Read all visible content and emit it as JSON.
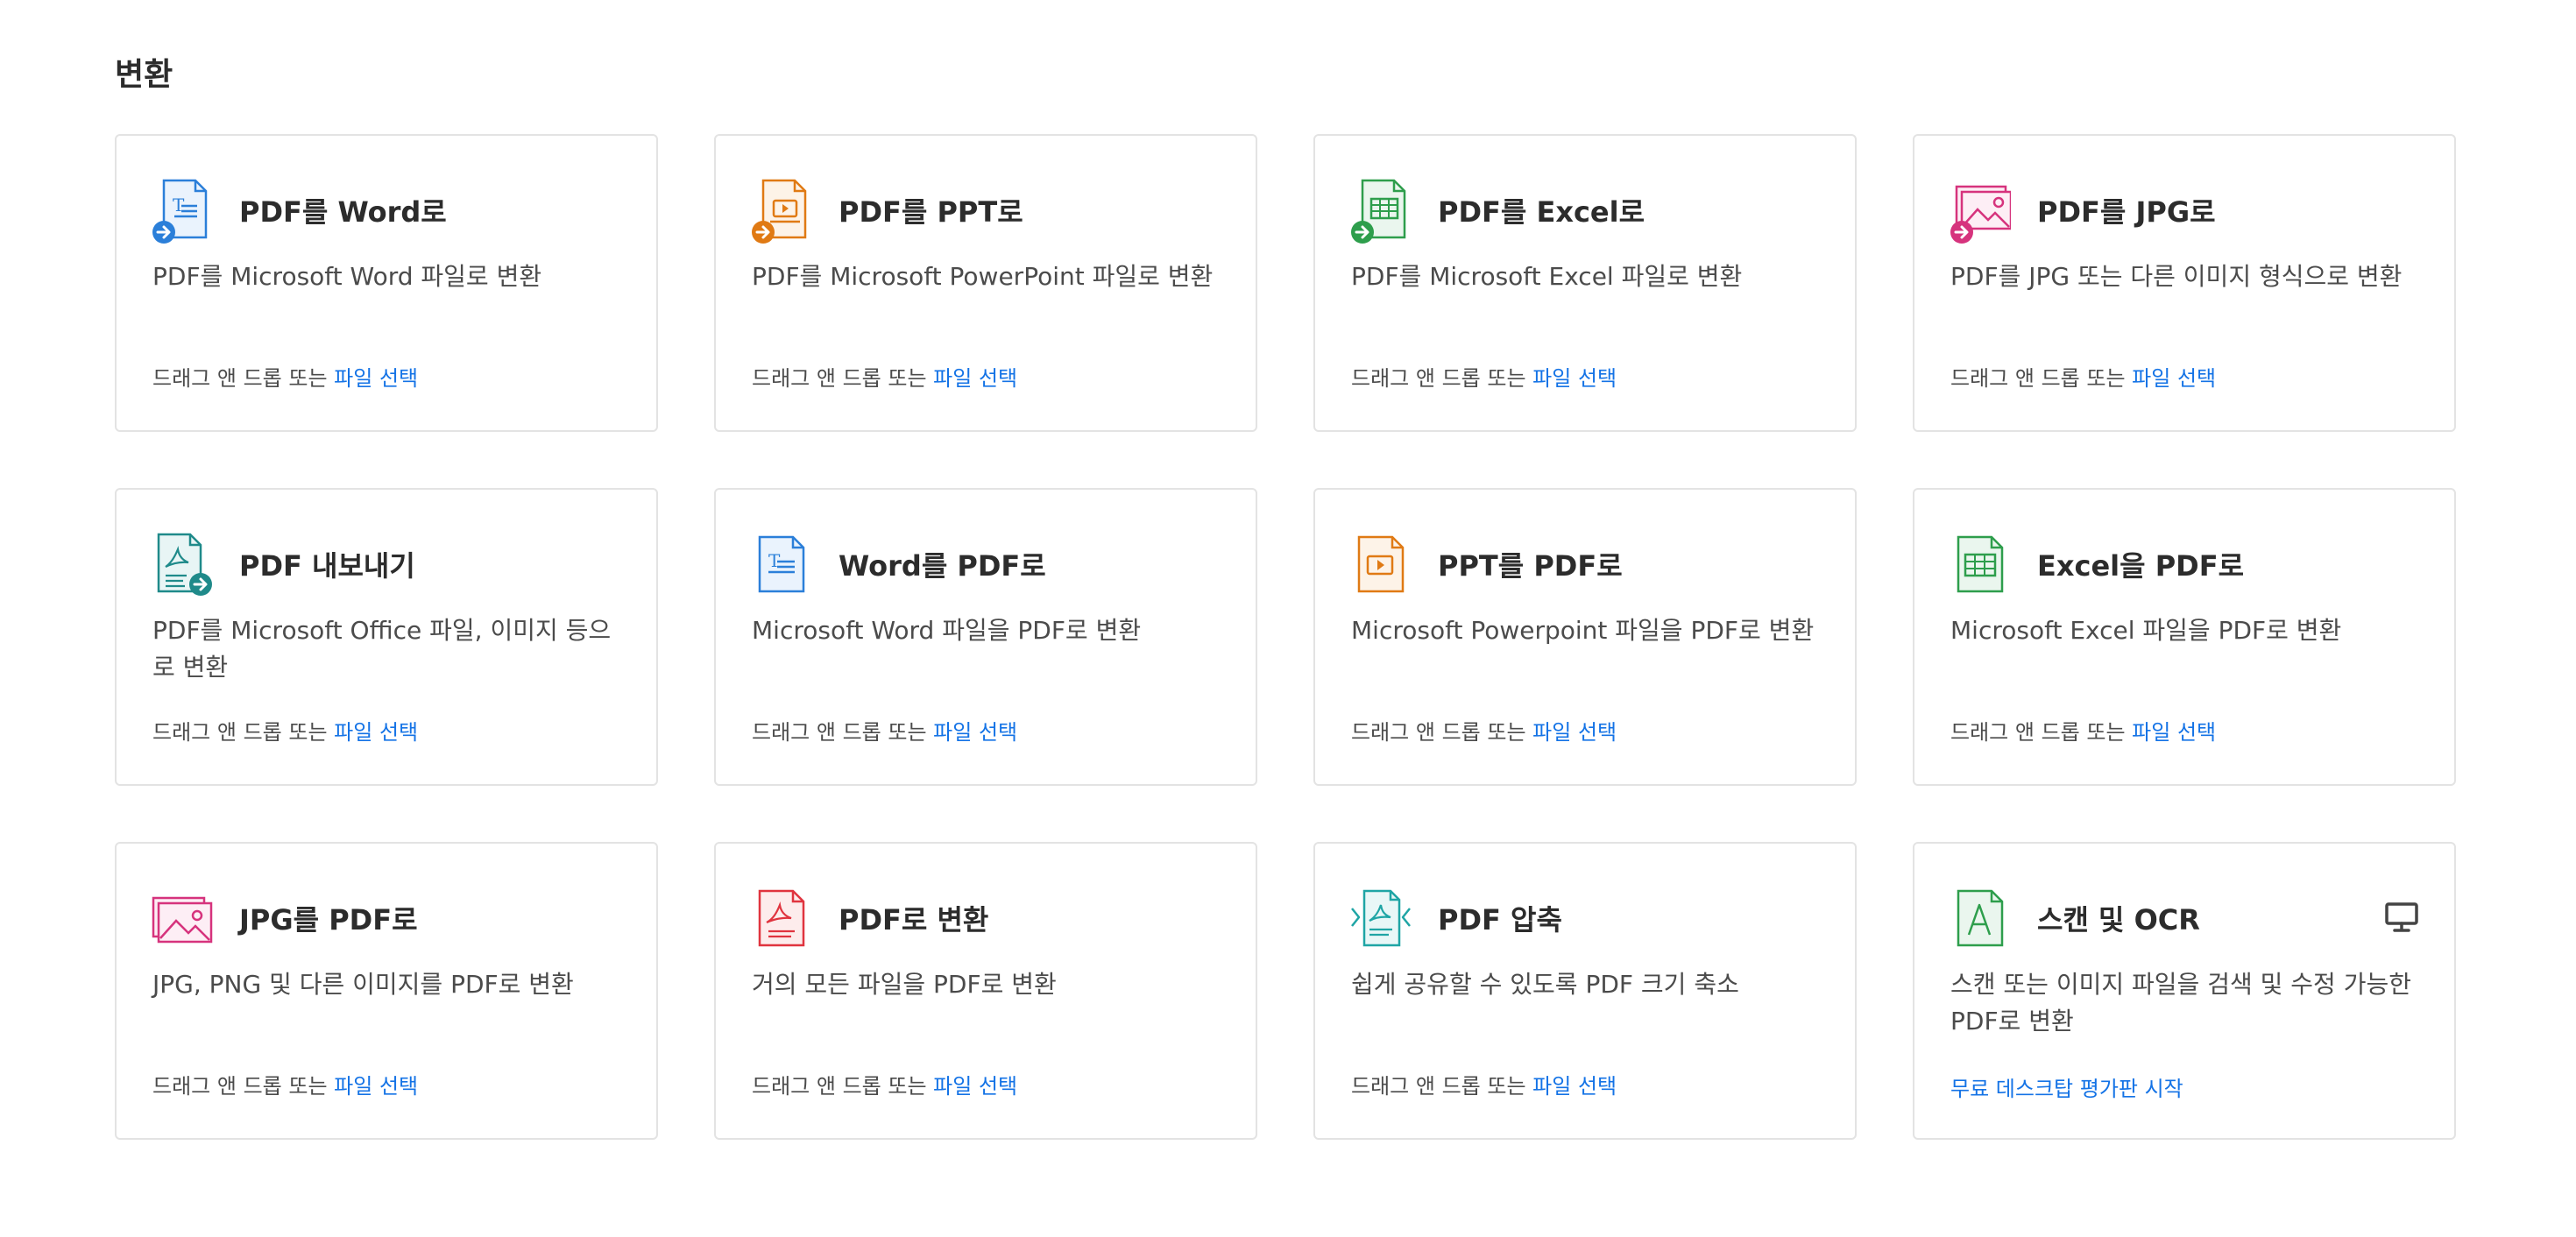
{
  "section": {
    "title": "변환"
  },
  "action_prefix": "드래그 앤 드롭 또는 ",
  "action_link": "파일 선택",
  "cards": [
    {
      "title": "PDF를 Word로",
      "desc": "PDF를 Microsoft Word 파일로 변환",
      "icon": "pdf-to-word-icon",
      "color": "#2b7fd9"
    },
    {
      "title": "PDF를 PPT로",
      "desc": "PDF를 Microsoft PowerPoint 파일로 변환",
      "icon": "pdf-to-ppt-icon",
      "color": "#e07a14"
    },
    {
      "title": "PDF를 Excel로",
      "desc": "PDF를 Microsoft Excel 파일로 변환",
      "icon": "pdf-to-excel-icon",
      "color": "#2e9e4c"
    },
    {
      "title": "PDF를 JPG로",
      "desc": "PDF를 JPG 또는 다른 이미지 형식으로 변환",
      "icon": "pdf-to-jpg-icon",
      "color": "#d6337d"
    },
    {
      "title": "PDF 내보내기",
      "desc": "PDF를 Microsoft Office 파일, 이미지 등으로 변환",
      "icon": "export-pdf-icon",
      "color": "#1f8a8a"
    },
    {
      "title": "Word를 PDF로",
      "desc": "Microsoft Word 파일을 PDF로 변환",
      "icon": "word-to-pdf-icon",
      "color": "#2b7fd9"
    },
    {
      "title": "PPT를 PDF로",
      "desc": "Microsoft Powerpoint 파일을 PDF로 변환",
      "icon": "ppt-to-pdf-icon",
      "color": "#e07a14"
    },
    {
      "title": "Excel을 PDF로",
      "desc": "Microsoft Excel 파일을 PDF로 변환",
      "icon": "excel-to-pdf-icon",
      "color": "#2e9e4c"
    },
    {
      "title": "JPG를 PDF로",
      "desc": "JPG, PNG 및 다른 이미지를 PDF로 변환",
      "icon": "jpg-to-pdf-icon",
      "color": "#d6337d"
    },
    {
      "title": "PDF로 변환",
      "desc": "거의 모든 파일을 PDF로 변환",
      "icon": "create-pdf-icon",
      "color": "#e0343f"
    },
    {
      "title": "PDF 압축",
      "desc": "쉽게 공유할 수 있도록 PDF 크기 축소",
      "icon": "compress-pdf-icon",
      "color": "#1fa5a5"
    },
    {
      "title": "스캔 및 OCR",
      "desc": "스캔 또는 이미지 파일을 검색 및 수정 가능한 PDF로 변환",
      "icon": "scan-ocr-icon",
      "color": "#2e9e4c",
      "cta": "무료 데스크탑 평가판 시작",
      "badge_icon": "desktop-icon"
    }
  ]
}
